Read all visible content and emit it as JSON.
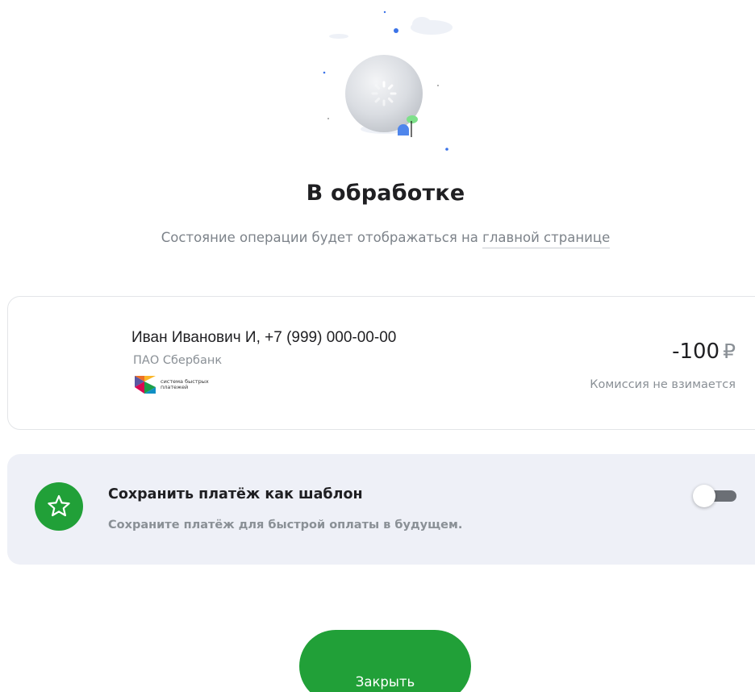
{
  "status": {
    "title": "В обработке",
    "subtitle_text": "Состояние операции будет отображаться на",
    "subtitle_link": "главной странице"
  },
  "payment": {
    "recipient": "Иван Иванович И, +7 (999) 000-00-00",
    "bank": "ПАО Сбербанк",
    "sbp_logo_text": "система быстрых платежей",
    "amount": "-100",
    "currency": "₽",
    "commission": "Комиссия не взимается"
  },
  "template": {
    "title": "Сохранить платёж как шаблон",
    "description": "Сохраните платёж для быстрой оплаты в будущем.",
    "toggle_on": false
  },
  "actions": {
    "close_label": "Закрыть"
  },
  "colors": {
    "accent": "#21a038",
    "template_bg": "#eef0f7",
    "muted_text": "#8a9096",
    "toggle_track": "#6b6f75"
  },
  "icons": {
    "status": "loading-spinner-icon",
    "template": "star-icon",
    "payment_system": "sbp-logo-icon"
  }
}
